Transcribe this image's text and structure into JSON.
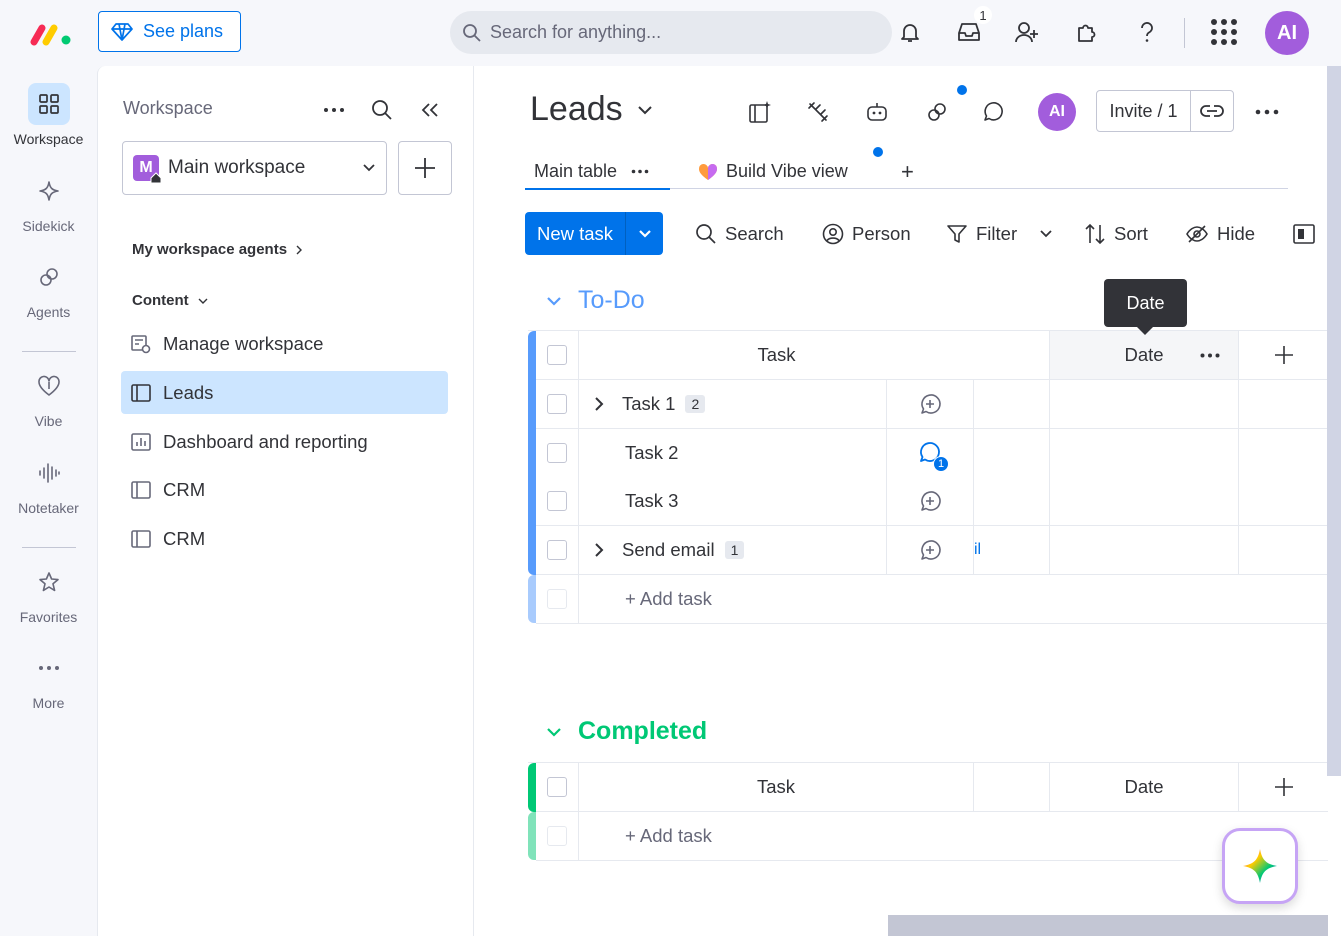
{
  "topbar": {
    "see_plans": "See plans",
    "search_placeholder": "Search for anything...",
    "inbox_count": "1",
    "avatar_initials": "AI"
  },
  "rail": {
    "items": [
      {
        "label": "Workspace",
        "icon": "grid-icon"
      },
      {
        "label": "Sidekick",
        "icon": "sparkle-icon"
      },
      {
        "label": "Agents",
        "icon": "agents-icon"
      },
      {
        "label": "Vibe",
        "icon": "heart-icon"
      },
      {
        "label": "Notetaker",
        "icon": "waveform-icon"
      },
      {
        "label": "Favorites",
        "icon": "star-icon"
      },
      {
        "label": "More",
        "icon": "more-icon"
      }
    ]
  },
  "workspace": {
    "title": "Workspace",
    "selected": "Main workspace",
    "selected_initial": "M",
    "agents_section": "My workspace agents",
    "content_section": "Content",
    "items": [
      {
        "label": "Manage workspace",
        "icon": "manage-icon"
      },
      {
        "label": "Leads",
        "icon": "board-icon"
      },
      {
        "label": "Dashboard and reporting",
        "icon": "dashboard-icon"
      },
      {
        "label": "CRM",
        "icon": "board-icon"
      },
      {
        "label": "CRM",
        "icon": "board-icon"
      }
    ]
  },
  "board": {
    "title": "Leads",
    "avatar_initials": "AI",
    "invite_label": "Invite / 1",
    "tabs": [
      {
        "label": "Main table"
      },
      {
        "label": "Build Vibe view"
      }
    ],
    "add_tab": "+",
    "new_task": "New task",
    "toolbar": {
      "search": "Search",
      "person": "Person",
      "filter": "Filter",
      "sort": "Sort",
      "hide": "Hide"
    },
    "tooltip": "Date",
    "groups": [
      {
        "title": "To-Do",
        "color": "#579bfc",
        "columns": {
          "task": "Task",
          "date": "Date"
        },
        "rows": [
          {
            "name": "Task 1",
            "subitems": "2",
            "expandable": true,
            "comment_count": ""
          },
          {
            "name": "Task 2",
            "subitems": "",
            "expandable": false,
            "comment_count": "1"
          },
          {
            "name": "Task 3",
            "subitems": "",
            "expandable": false,
            "comment_count": ""
          },
          {
            "name": "Send email",
            "subitems": "1",
            "expandable": true,
            "comment_count": ""
          }
        ],
        "add_task": "+ Add task",
        "partial_text": "il"
      },
      {
        "title": "Completed",
        "color": "#00c875",
        "columns": {
          "task": "Task",
          "date": "Date"
        },
        "add_task": "+ Add task"
      }
    ]
  }
}
